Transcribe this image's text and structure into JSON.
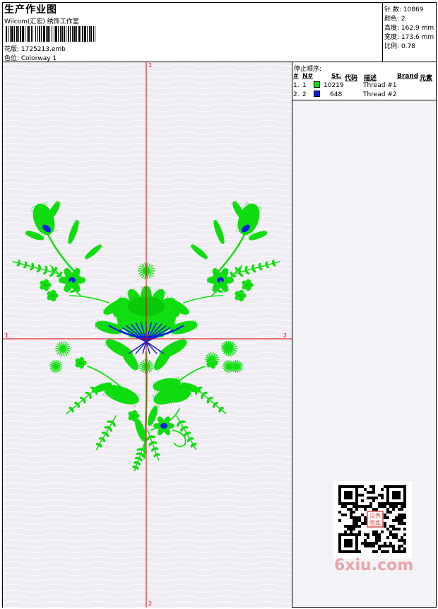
{
  "header": {
    "title": "生产作业图",
    "company": "Wilcom(汇宏) 绣饰工作室",
    "design_line": "花版:  1725213.emb",
    "colorway_line": "色位:  Colorway 1"
  },
  "stats": [
    {
      "label": "针 数:",
      "value": "10869"
    },
    {
      "label": "颜色:",
      "value": "2"
    },
    {
      "label": "高度:",
      "value": "162.9 mm"
    },
    {
      "label": "宽度:",
      "value": "173.6 mm"
    },
    {
      "label": "比例:",
      "value": "0.78"
    }
  ],
  "legend": {
    "title": "停止顺序:",
    "headers": {
      "hash": "#",
      "no": "N#",
      "st": "St.",
      "code": "代码",
      "desc": "描述",
      "brand": "Brand",
      "elem": "元素"
    },
    "rows": [
      {
        "seq": "1.",
        "num": "1",
        "color": "#10e010",
        "code": "10219",
        "desc": "Thread #1"
      },
      {
        "seq": "2.",
        "num": "2",
        "color": "#0a20e0",
        "code": "648",
        "desc": "Thread #2"
      }
    ]
  },
  "axis_labels": {
    "top": "1",
    "bottom": "2",
    "left": "1",
    "right": "2"
  },
  "watermark": "6xiu.com",
  "qr_stamp": "汉秀图库",
  "colors": {
    "thread1": "#10e010",
    "thread2": "#0a20e0",
    "axis": "#e00000"
  }
}
